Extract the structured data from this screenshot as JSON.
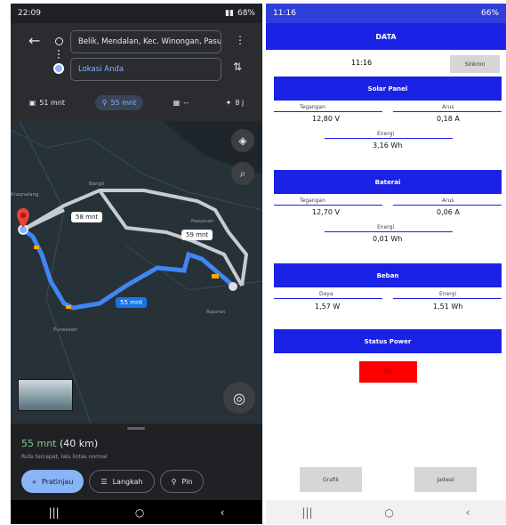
{
  "maps": {
    "status": {
      "time": "22:09",
      "battery": "68%"
    },
    "origin": "Belik, Mendalan, Kec. Winongan, Pasu...",
    "destination": "Lokasi Anda",
    "modes": [
      {
        "icon": "car-icon",
        "label": "51 mnt"
      },
      {
        "icon": "motorcycle-icon",
        "label": "55 mnt"
      },
      {
        "icon": "transit-icon",
        "label": "--"
      },
      {
        "icon": "walk-icon",
        "label": "8 j"
      }
    ],
    "map_labels": {
      "route_alt1": "58 mnt",
      "route_alt2": "59 mnt",
      "route_main": "55 mnt",
      "place_a": "Kraqnalang",
      "place_b": "Bangil",
      "place_c": "Pasuruan",
      "place_d": "Purwosari",
      "place_e": "Bajoran"
    },
    "eta_time": "55 mnt",
    "eta_distance": "(40 km)",
    "route_note": "Rute tercepat, lalu lintas normal",
    "buttons": {
      "preview": "Pratinjau",
      "steps": "Langkah",
      "pin": "Pin"
    }
  },
  "data_app": {
    "status": {
      "time": "11:16",
      "battery": "66%"
    },
    "title": "DATA",
    "time_value": "11:16",
    "sync_label": "Sinkron",
    "solar": {
      "title": "Solar Panel",
      "voltage_label": "Tegangan",
      "voltage": "12,80 V",
      "current_label": "Arus",
      "current": "0,18 A",
      "energy_label": "Energi",
      "energy": "3,16 Wh"
    },
    "battery": {
      "title": "Baterai",
      "voltage_label": "Tegangan",
      "voltage": "12,70 V",
      "current_label": "Arus",
      "current": "0,06 A",
      "energy_label": "Energi",
      "energy": "0,01 Wh"
    },
    "load": {
      "title": "Beban",
      "power_label": "Daya",
      "power": "1,57 W",
      "energy_label": "Energi",
      "energy": "1,51 Wh"
    },
    "power_status_title": "Status Power",
    "power_status_value": "OFF",
    "buttons": {
      "graph": "Grafik",
      "schedule": "Jadwal"
    }
  },
  "colors": {
    "accent_blue": "#1a22e6",
    "maps_blue": "#1a73e8",
    "status_red": "#ff0000"
  }
}
